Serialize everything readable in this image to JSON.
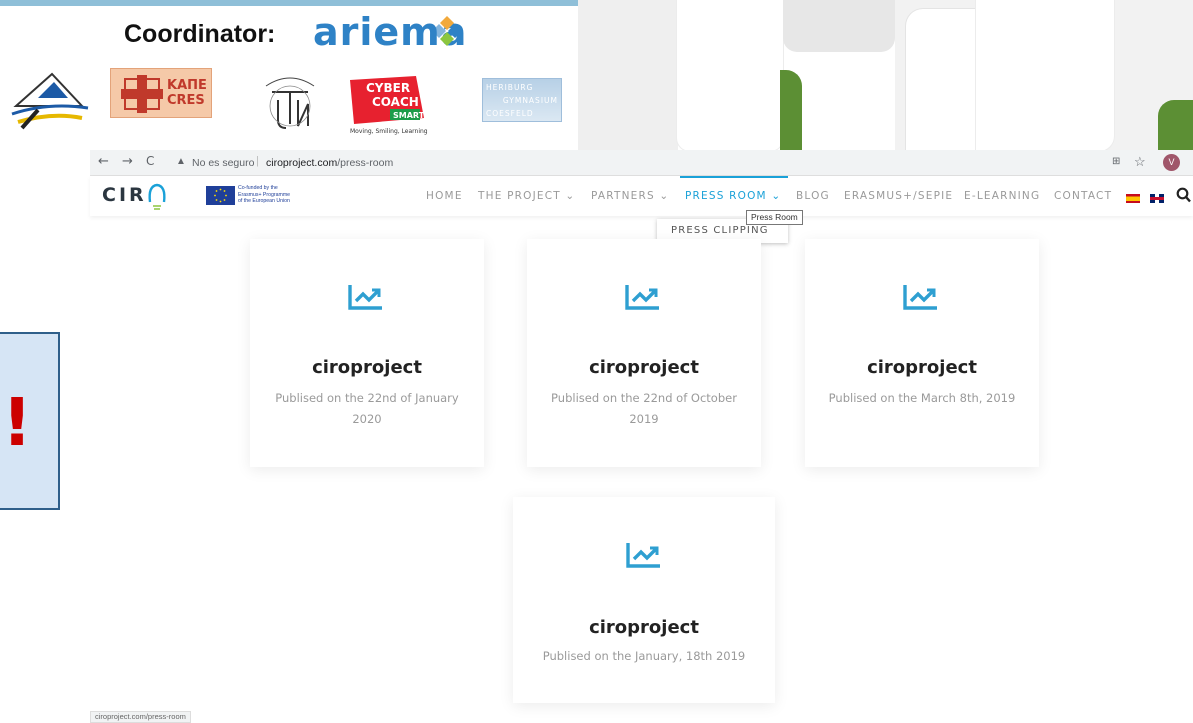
{
  "slide": {
    "coordinator_label": "Coordinator:",
    "coordinator_name": "ariema",
    "partner_logos": {
      "kape_line1": "ΚΑΠΕ",
      "kape_line2": "CRES",
      "cyber_line1": "CYBER",
      "cyber_line2": "COACH",
      "cyber_line3": "SMART",
      "cyber_tagline": "Moving, Smiling, Learning",
      "heriburg_line1": "HERIBURG",
      "heriburg_line2": "GYMNASIUM",
      "heriburg_line3": "COESFELD"
    },
    "alert_symbol": "!",
    "colors": {
      "accent_green": "#5c8f34",
      "alert_red": "#cc0000",
      "alert_box": "#d6e5f5"
    }
  },
  "browser": {
    "nav_back": "←",
    "nav_forward": "→",
    "nav_reload": "C",
    "insecure_label": "No es seguro",
    "url_host": "ciroproject.com",
    "url_path": "/press-room",
    "avatar_letter": "V",
    "status_url": "ciroproject.com/press-room"
  },
  "site": {
    "logo_text": "CIR",
    "eu_text": [
      "Co-funded by the",
      "Erasmus+ Programme",
      "of the European Union"
    ],
    "menu": [
      {
        "label": "HOME"
      },
      {
        "label": "THE PROJECT ⌄"
      },
      {
        "label": "PARTNERS ⌄"
      },
      {
        "label": "PRESS ROOM ⌄",
        "active": true
      },
      {
        "label": "BLOG"
      },
      {
        "label": "ERASMUS+/SEPIE"
      },
      {
        "label": "E-LEARNING"
      },
      {
        "label": "CONTACT"
      }
    ],
    "dropdown_item": "PRESS CLIPPING",
    "tooltip": "Press Room",
    "accent_color": "#1aa1d8"
  },
  "cards": [
    {
      "title": "ciroproject",
      "date": "Publised on the 22nd of January 2020"
    },
    {
      "title": "ciroproject",
      "date": "Publised on the 22nd of October 2019"
    },
    {
      "title": "ciroproject",
      "date": "Publised on the March 8th, 2019"
    },
    {
      "title": "ciroproject",
      "date": "Publised on the January, 18th 2019"
    }
  ]
}
